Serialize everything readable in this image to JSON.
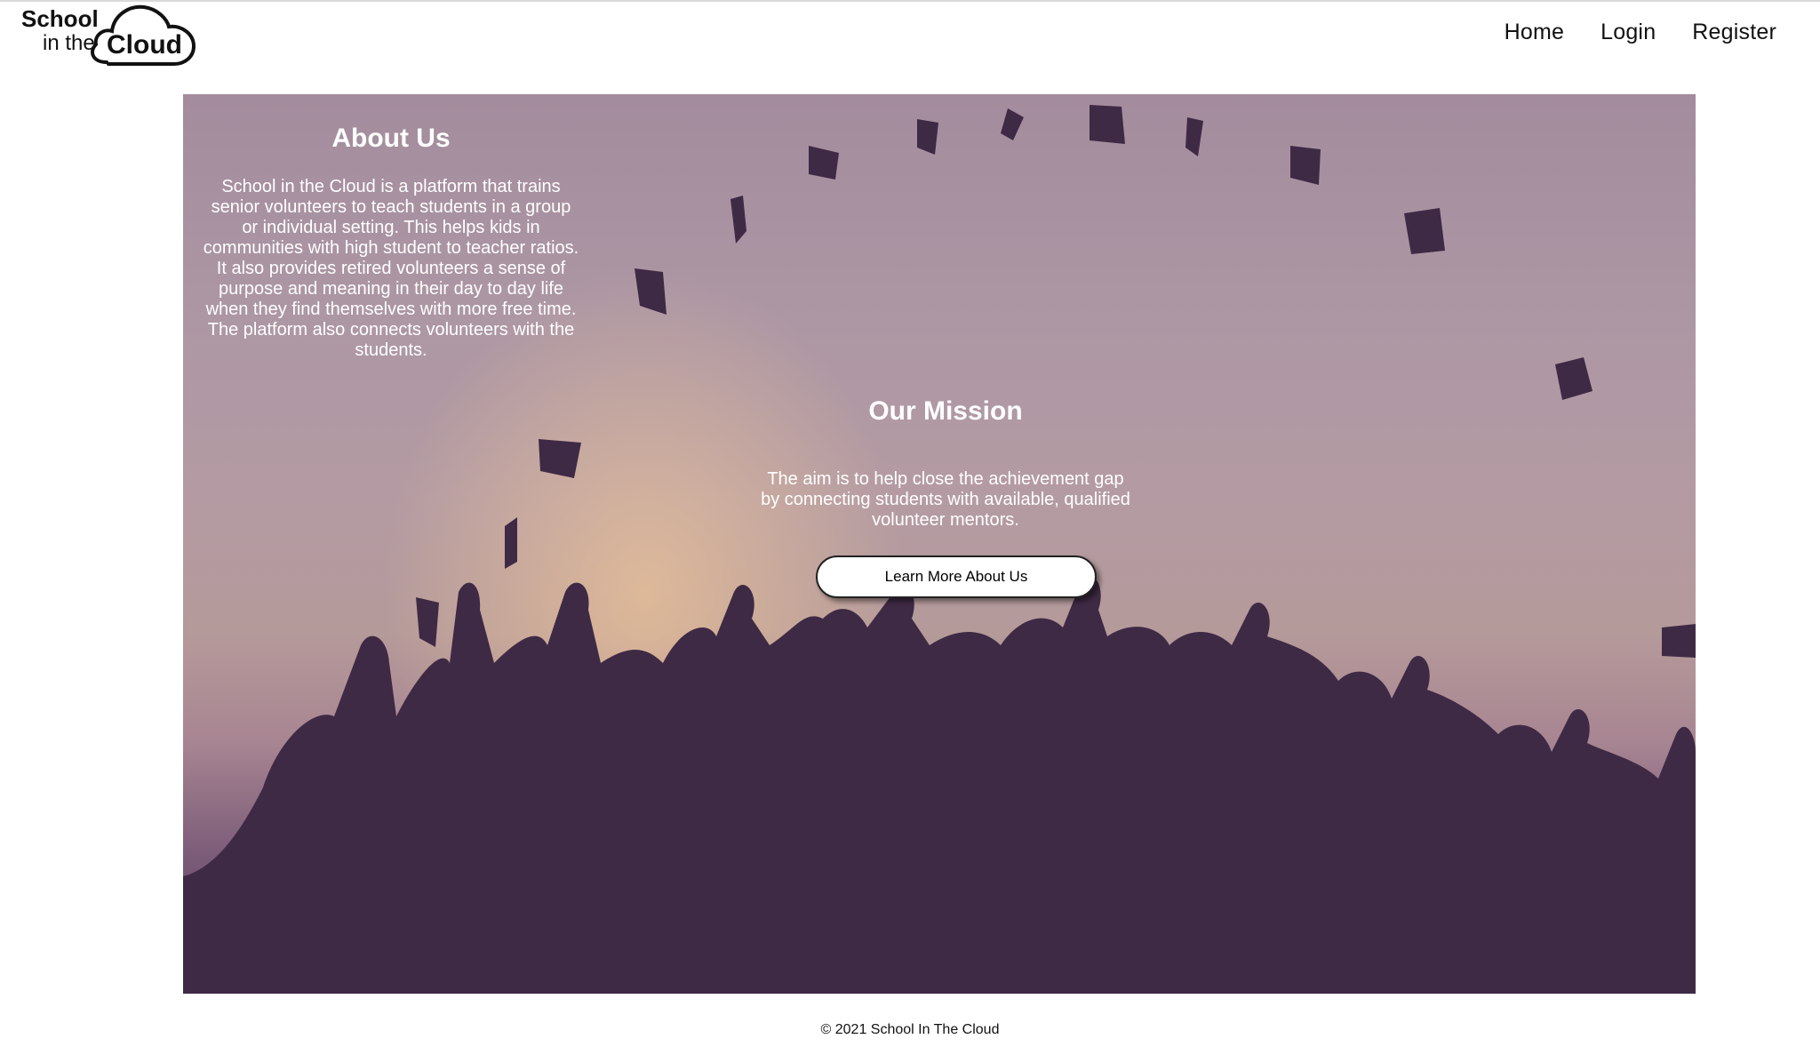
{
  "brand": {
    "logo_line1": "School",
    "logo_line2": "in the",
    "logo_word": "Cloud"
  },
  "nav": {
    "items": [
      {
        "label": "Home"
      },
      {
        "label": "Login"
      },
      {
        "label": "Register"
      }
    ]
  },
  "about": {
    "heading": "About Us",
    "body": "School in the Cloud is a platform that trains senior volunteers to teach students in a group or individual setting. This helps kids in communities with high student to teacher ratios. It also provides retired volunteers a sense of purpose and meaning in their day to day life when they find themselves with more free time. The platform also connects volunteers with the students."
  },
  "mission": {
    "heading": "Our Mission",
    "body": "The aim is to help close the achievement gap by connecting students with available, qualified volunteer mentors.",
    "button_label": "Learn More About Us"
  },
  "footer": {
    "copyright": "© 2021 School In The Cloud"
  },
  "colors": {
    "silhouette": "#3f2a45",
    "hero_text": "#ffffff"
  }
}
